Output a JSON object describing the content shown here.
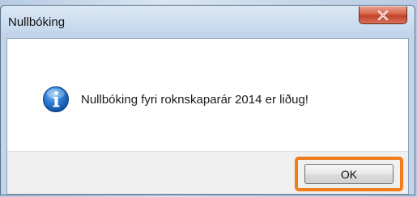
{
  "dialog": {
    "title": "Nullbóking",
    "close_icon": "close-x-icon",
    "message_icon": "information-icon",
    "message": "Nullbóking fyri roknskaparár 2014 er liðug!",
    "ok_label": "OK",
    "highlight_color": "#f07d1c",
    "close_button_color": "#c7432d"
  }
}
